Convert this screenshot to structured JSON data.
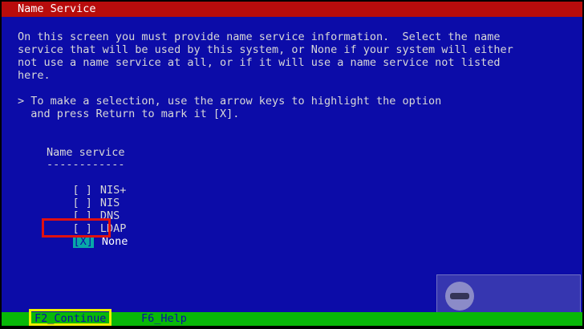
{
  "window": {
    "title": "Name Service"
  },
  "instructions": {
    "paragraph_lines": [
      "On this screen you must provide name service information.  Select the name",
      "service that will be used by this system, or None if your system will either",
      "not use a name service at all, or if it will use a name service not listed",
      "here."
    ],
    "hint_lines": [
      "> To make a selection, use the arrow keys to highlight the option",
      "  and press Return to mark it [X]."
    ]
  },
  "name_service": {
    "heading": "Name service",
    "underline": "------------",
    "options": [
      {
        "box": "[ ]",
        "label": "NIS+",
        "selected": false
      },
      {
        "box": "[ ]",
        "label": "NIS",
        "selected": false
      },
      {
        "box": "[ ]",
        "label": "DNS",
        "selected": false
      },
      {
        "box": "[ ]",
        "label": "LDAP",
        "selected": false
      },
      {
        "box": "[X]",
        "label": "None",
        "selected": true
      }
    ]
  },
  "footer": {
    "continue_label": "F2_Continue",
    "help_label": "F6_Help"
  },
  "colors": {
    "background": "#0c0ca8",
    "title_bar": "#b80c0c",
    "footer_bar": "#08b808",
    "text": "#d8d8d8",
    "selection": "#08a8a8",
    "callout_red": "#e01010",
    "callout_yellow": "#f0f000"
  },
  "icons": {
    "watermark": "penguin-logo-icon"
  }
}
